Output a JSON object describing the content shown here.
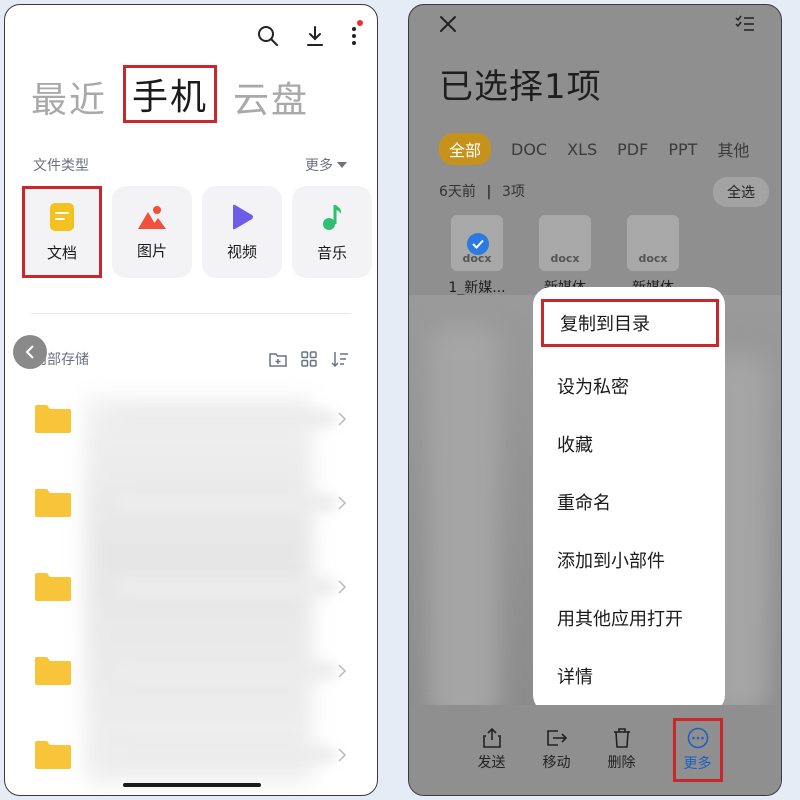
{
  "left": {
    "main_tabs": [
      "最近",
      "手机",
      "云盘"
    ],
    "active_tab": "手机",
    "file_types_label": "文件类型",
    "more_label": "更多",
    "types": [
      {
        "label": "文档",
        "icon": "document-icon",
        "color": "#f4c21e"
      },
      {
        "label": "图片",
        "icon": "image-icon",
        "color": "#f0503c"
      },
      {
        "label": "视频",
        "icon": "video-icon",
        "color": "#6c5ce7"
      },
      {
        "label": "音乐",
        "icon": "music-icon",
        "color": "#2fbf71"
      }
    ],
    "storage_label": "内部存储",
    "folder_color": "#f8c53a",
    "folder_count": 5
  },
  "right": {
    "title": "已选择1项",
    "filters": [
      "全部",
      "DOC",
      "XLS",
      "PDF",
      "PPT",
      "其他"
    ],
    "active_filter": "全部",
    "date_label": "6天前",
    "count_label": "3项",
    "select_all": "全选",
    "files": [
      {
        "name": "1_新媒...",
        "ext": "docx",
        "selected": true
      },
      {
        "name": "新媒体",
        "ext": "docx",
        "selected": false
      },
      {
        "name": "新媒体",
        "ext": "docx",
        "selected": false
      }
    ],
    "menu": [
      "复制到目录",
      "设为私密",
      "收藏",
      "重命名",
      "添加到小部件",
      "用其他应用打开",
      "详情"
    ],
    "actions": [
      "发送",
      "移动",
      "删除",
      "更多"
    ],
    "accent_color": "#c6921b",
    "highlight_color": "#c8282a"
  }
}
